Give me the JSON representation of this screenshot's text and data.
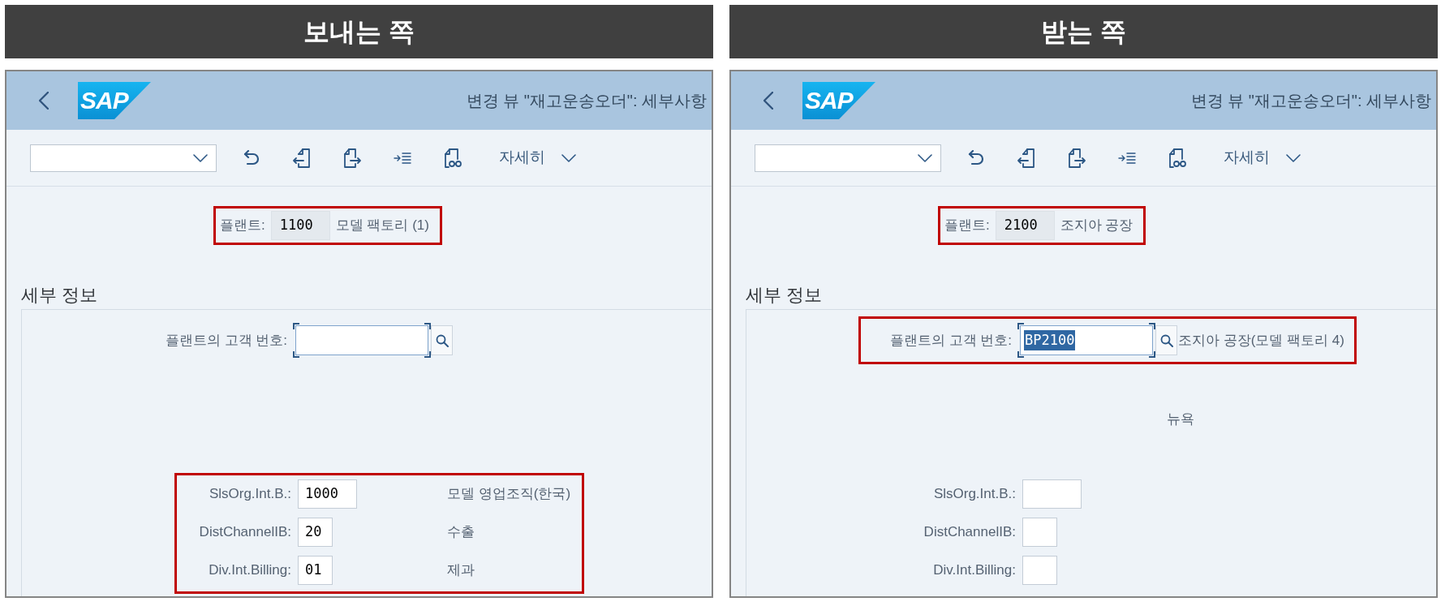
{
  "panels": [
    {
      "heading": "보내는 쪽",
      "window": {
        "logo": "SAP",
        "title": "변경 뷰 \"재고운송오더\": 세부사항"
      },
      "toolbar": {
        "menu_label": "자세히"
      },
      "plant": {
        "label": "플랜트:",
        "value": "1100",
        "description": "모델 팩토리 (1)",
        "highlighted": true
      },
      "section": {
        "title": "세부 정보",
        "customer": {
          "label": "플랜트의 고객 번호:",
          "focused": true,
          "highlighted": false
        },
        "fields_highlighted": true,
        "fields": [
          {
            "label": "SlsOrg.Int.B.:",
            "value": "1000",
            "description": "모델 영업조직(한국)"
          },
          {
            "label": "DistChannelIB:",
            "value": "20",
            "description": "수출"
          },
          {
            "label": "Div.Int.Billing:",
            "value": "01",
            "description": "제과"
          }
        ]
      }
    },
    {
      "heading": "받는 쪽",
      "window": {
        "logo": "SAP",
        "title": "변경 뷰 \"재고운송오더\": 세부사항"
      },
      "toolbar": {
        "menu_label": "자세히"
      },
      "plant": {
        "label": "플랜트:",
        "value": "2100",
        "description": "조지아 공장",
        "highlighted": true
      },
      "section": {
        "title": "세부 정보",
        "customer": {
          "label": "플랜트의 고객 번호:",
          "value": "BP2100",
          "value_selected": true,
          "description": "조지아 공장(모델 팩토리 4)",
          "focused": true,
          "highlighted": true
        },
        "note": "뉴욕",
        "fields_highlighted": false,
        "fields": [
          {
            "label": "SlsOrg.Int.B.:"
          },
          {
            "label": "DistChannelIB:"
          },
          {
            "label": "Div.Int.Billing:"
          }
        ]
      }
    }
  ]
}
